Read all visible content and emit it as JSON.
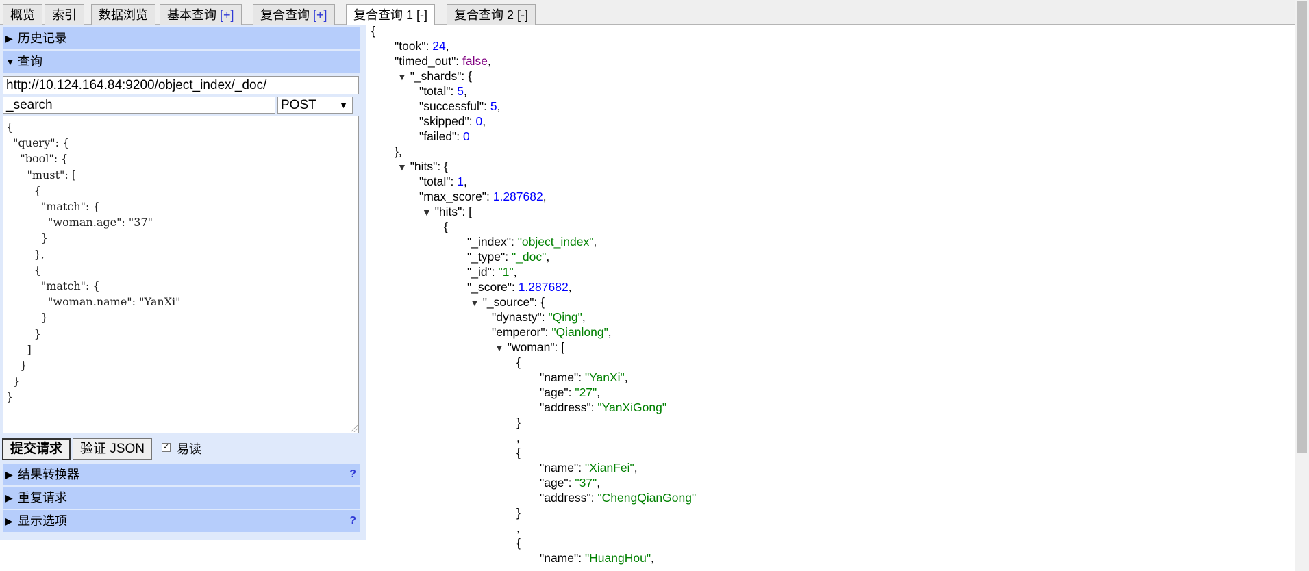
{
  "tabs": [
    {
      "label": "概览",
      "pm": ""
    },
    {
      "label": "索引",
      "pm": ""
    },
    {
      "label": "数据浏览",
      "pm": ""
    },
    {
      "label": "基本查询 ",
      "pm": "[+]"
    },
    {
      "label": "复合查询 ",
      "pm": "[+]"
    },
    {
      "label": "复合查询 1 [-]",
      "pm": ""
    },
    {
      "label": "复合查询 2 [-]",
      "pm": ""
    }
  ],
  "left": {
    "history_label": "历史记录",
    "query_label": "查询",
    "url_value": "http://10.124.164.84:9200/object_index/_doc/",
    "path_value": "_search",
    "method_value": "POST",
    "body_text": "{\n  \"query\": {\n    \"bool\": {\n      \"must\": [\n        {\n          \"match\": {\n            \"woman.age\": \"37\"\n          }\n        },\n        {\n          \"match\": {\n            \"woman.name\": \"YanXi\"\n          }\n        }\n      ]\n    }\n  }\n}",
    "submit_label": "提交请求",
    "validate_label": "验证 JSON",
    "readable_label": "易读",
    "transformer_label": "结果转换器",
    "repeat_label": "重复请求",
    "display_label": "显示选项",
    "help_symbol": "?"
  },
  "json": {
    "took": "24",
    "timed_out": "false",
    "shards_total": "5",
    "shards_successful": "5",
    "shards_skipped": "0",
    "shards_failed": "0",
    "hits_total": "1",
    "max_score": "1.287682",
    "hit_index": "\"object_index\"",
    "hit_type": "\"_doc\"",
    "hit_id": "\"1\"",
    "hit_score": "1.287682",
    "dynasty": "\"Qing\"",
    "emperor": "\"Qianlong\"",
    "w1_name": "\"YanXi\"",
    "w1_age": "\"27\"",
    "w1_address": "\"YanXiGong\"",
    "w2_name": "\"XianFei\"",
    "w2_age": "\"37\"",
    "w2_address": "\"ChengQianGong\"",
    "w3_name": "\"HuangHou\""
  }
}
